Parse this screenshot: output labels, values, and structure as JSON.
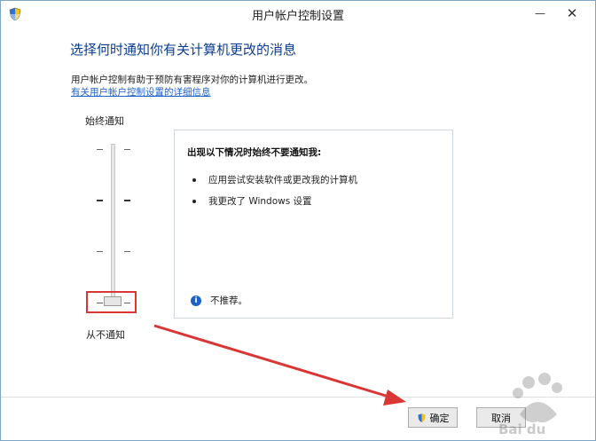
{
  "window": {
    "title": "用户帐户控制设置"
  },
  "titlebar": {
    "minimize": "—",
    "close": "✕"
  },
  "main": {
    "heading": "选择何时通知你有关计算机更改的消息",
    "description": "用户帐户控制有助于预防有害程序对你的计算机进行更改。",
    "link": "有关用户帐户控制设置的详细信息"
  },
  "slider": {
    "top_label": "始终通知",
    "bottom_label": "从不通知",
    "levels": 4,
    "selected_level": 1
  },
  "infobox": {
    "title": "出现以下情况时始终不要通知我:",
    "bullets": [
      "应用尝试安装软件或更改我的计算机",
      "我更改了 Windows 设置"
    ],
    "note_icon": "i",
    "note": "不推荐。"
  },
  "buttons": {
    "ok": "确定",
    "cancel": "取消"
  },
  "colors": {
    "heading": "#0c3d8f",
    "link": "#1e62c8",
    "annotation": "#d93636"
  },
  "watermark": {
    "text": "Bai du"
  }
}
